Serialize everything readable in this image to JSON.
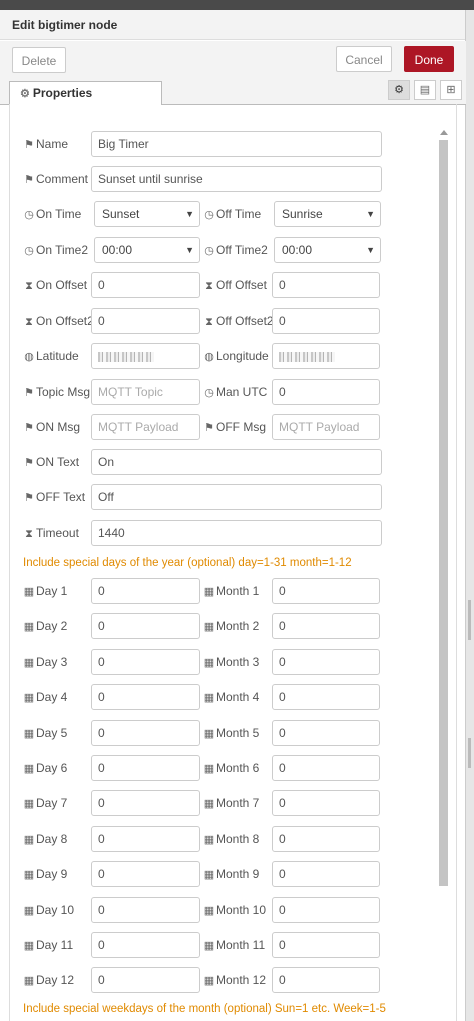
{
  "dialog": {
    "title": "Edit bigtimer node"
  },
  "buttons": {
    "delete": "Delete",
    "cancel": "Cancel",
    "done": "Done"
  },
  "tabs": {
    "properties": "Properties"
  },
  "fields": {
    "name": {
      "label": "Name",
      "value": "Big Timer"
    },
    "comment": {
      "label": "Comment",
      "value": "Sunset until sunrise"
    },
    "on_time": {
      "label": "On Time",
      "value": "Sunset"
    },
    "off_time": {
      "label": "Off Time",
      "value": "Sunrise"
    },
    "on_time2": {
      "label": "On Time2",
      "value": "00:00"
    },
    "off_time2": {
      "label": "Off Time2",
      "value": "00:00"
    },
    "on_offset": {
      "label": "On Offset",
      "value": "0"
    },
    "off_offset": {
      "label": "Off Offset",
      "value": "0"
    },
    "on_offset2": {
      "label": "On Offset2",
      "value": "0"
    },
    "off_offset2": {
      "label": "Off Offset2",
      "value": "0"
    },
    "latitude": {
      "label": "Latitude"
    },
    "longitude": {
      "label": "Longitude"
    },
    "topic_msg": {
      "label": "Topic Msg",
      "placeholder": "MQTT Topic"
    },
    "man_utc": {
      "label": "Man UTC",
      "value": "0"
    },
    "on_msg": {
      "label": "ON Msg",
      "placeholder": "MQTT Payload"
    },
    "off_msg": {
      "label": "OFF Msg",
      "placeholder": "MQTT Payload"
    },
    "on_text": {
      "label": "ON Text",
      "value": "On"
    },
    "off_text": {
      "label": "OFF Text",
      "value": "Off"
    },
    "timeout": {
      "label": "Timeout",
      "value": "1440"
    }
  },
  "notes": {
    "special_days": "Include special days of the year (optional) day=1-31 month=1-12",
    "special_weekdays": "Include special weekdays of the month (optional) Sun=1 etc. Week=1-5"
  },
  "special_days": [
    {
      "day_label": "Day 1",
      "day_value": "0",
      "month_label": "Month 1",
      "month_value": "0"
    },
    {
      "day_label": "Day 2",
      "day_value": "0",
      "month_label": "Month 2",
      "month_value": "0"
    },
    {
      "day_label": "Day 3",
      "day_value": "0",
      "month_label": "Month 3",
      "month_value": "0"
    },
    {
      "day_label": "Day 4",
      "day_value": "0",
      "month_label": "Month 4",
      "month_value": "0"
    },
    {
      "day_label": "Day 5",
      "day_value": "0",
      "month_label": "Month 5",
      "month_value": "0"
    },
    {
      "day_label": "Day 6",
      "day_value": "0",
      "month_label": "Month 6",
      "month_value": "0"
    },
    {
      "day_label": "Day 7",
      "day_value": "0",
      "month_label": "Month 7",
      "month_value": "0"
    },
    {
      "day_label": "Day 8",
      "day_value": "0",
      "month_label": "Month 8",
      "month_value": "0"
    },
    {
      "day_label": "Day 9",
      "day_value": "0",
      "month_label": "Month 9",
      "month_value": "0"
    },
    {
      "day_label": "Day 10",
      "day_value": "0",
      "month_label": "Month 10",
      "month_value": "0"
    },
    {
      "day_label": "Day 11",
      "day_value": "0",
      "month_label": "Month 11",
      "month_value": "0"
    },
    {
      "day_label": "Day 12",
      "day_value": "0",
      "month_label": "Month 12",
      "month_value": "0"
    }
  ]
}
